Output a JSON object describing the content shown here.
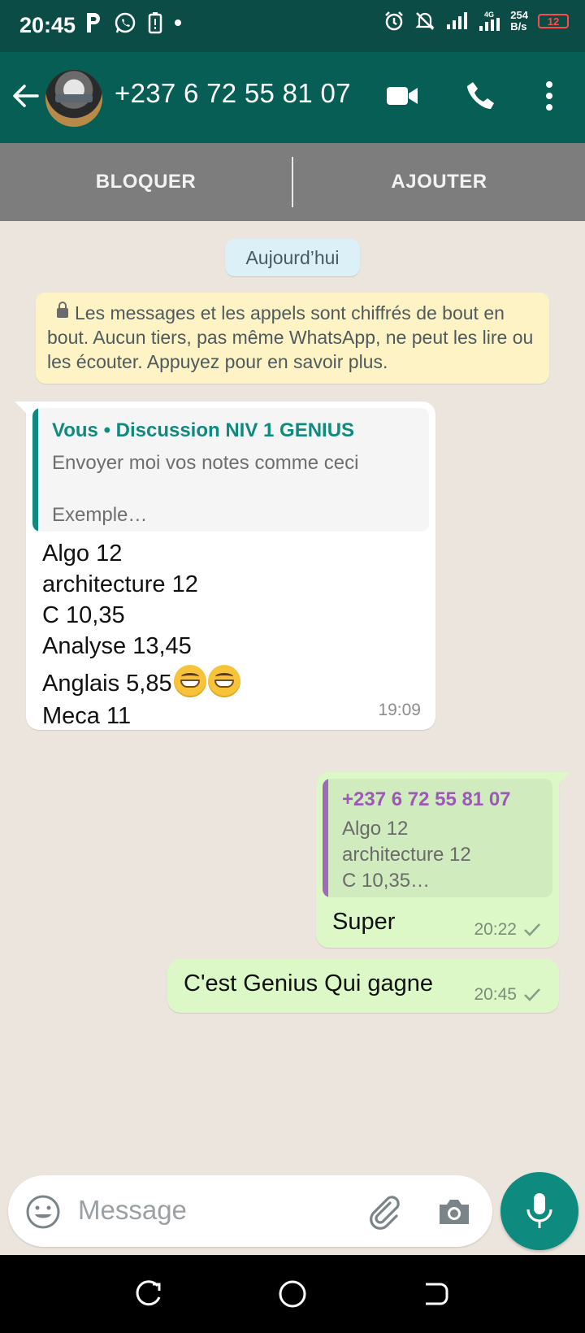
{
  "status_bar": {
    "time": "20:45",
    "speed_value": "254",
    "speed_unit": "B/s",
    "battery": "12",
    "network": "4G"
  },
  "header": {
    "contact_name": "+237 6 72 55 81 07"
  },
  "action_bar": {
    "block_label": "BLOQUER",
    "add_label": "AJOUTER"
  },
  "chat": {
    "date_chip": "Aujourd’hui",
    "encryption_notice": "Les messages et les appels sont chiffrés de bout en bout. Aucun tiers, pas même WhatsApp, ne peut les lire ou les écouter. Appuyez pour en savoir plus.",
    "incoming": {
      "quote_author": "Vous • Discussion NIV 1 GENIUS",
      "quote_text": "Envoyer moi vos notes comme ceci\n\nExemple…",
      "lines": [
        "Algo 12",
        "architecture 12",
        "C 10,35",
        "Analyse 13,45",
        "Anglais 5,85",
        "Meca 11"
      ],
      "time": "19:09"
    },
    "outgoing_reply": {
      "quote_author": "+237 6 72 55 81 07",
      "quote_text": "Algo 12\narchitecture 12\nC 10,35…",
      "text": "Super",
      "time": "20:22"
    },
    "outgoing_message": {
      "text": "C'est Genius Qui gagne",
      "time": "20:45"
    }
  },
  "composer": {
    "placeholder": "Message"
  },
  "colors": {
    "header": "#075e54",
    "accent": "#0e8a7e",
    "outgoing_bubble": "#dcf8c6"
  }
}
